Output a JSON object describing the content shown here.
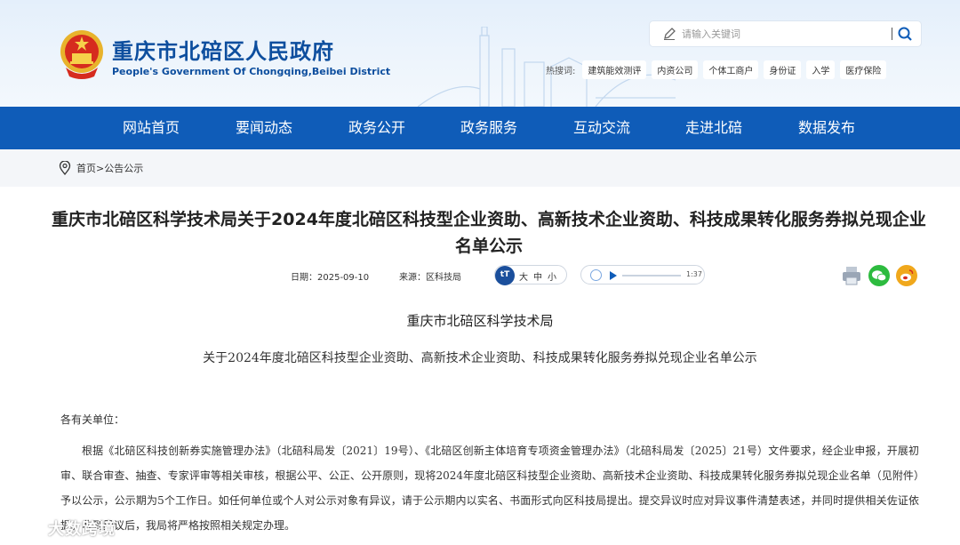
{
  "header": {
    "title": "重庆市北碚区人民政府",
    "subtitle": "People's Government Of Chongqing,Beibei District",
    "search_placeholder": "请输入关键词",
    "hot_label": "热搜词:",
    "hot_tags": [
      "建筑能效测评",
      "内资公司",
      "个体工商户",
      "身份证",
      "入学",
      "医疗保险"
    ]
  },
  "nav": {
    "items": [
      "网站首页",
      "要闻动态",
      "政务公开",
      "政务服务",
      "互动交流",
      "走进北碚",
      "数据发布"
    ],
    "active_index": 1
  },
  "breadcrumb": {
    "text": "首页>公告公示"
  },
  "article": {
    "title": "重庆市北碚区科学技术局关于2024年度北碚区科技型企业资助、高新技术企业资助、科技成果转化服务券拟兑现企业名单公示",
    "date": "日期：2025-09-10",
    "source": "来源：区科技局",
    "font_sizes": [
      "大",
      "中",
      "小"
    ],
    "font_icon": "tT",
    "audio_time": "1:37",
    "org": "重庆市北碚区科学技术局",
    "subtitle": "关于2024年度北碚区科技型企业资助、高新技术企业资助、科技成果转化服务券拟兑现企业名单公示",
    "salutation": "各有关单位：",
    "body": "根据《北碚区科技创新券实施管理办法》（北碚科局发〔2021〕19号）、《北碚区创新主体培育专项资金管理办法》（北碚科局发〔2025〕21号）文件要求，经企业申报，开展初审、联合审查、抽查、专家评审等相关审核，根据公平、公正、公开原则，现将2024年度北碚区科技型企业资助、高新技术企业资助、科技成果转化服务券拟兑现企业名单（见附件）予以公示，公示期为5个工作日。如任何单位或个人对公示对象有异议，请于公示期内以实名、书面形式向区科技局提出。提交异议时应对异议事件清楚表述，并同时提供相关佐证依据。收到异议后，我局将严格按照相关规定办理。"
  },
  "watermark": {
    "text": "大数跨境"
  },
  "colors": {
    "primary": "#0f5cb8",
    "title": "#0d4e9e",
    "wechat": "#2dbb3f",
    "weibo": "#f0a81c"
  },
  "icons": [
    "national-emblem-icon",
    "pencil-icon",
    "search-icon",
    "location-pin-icon",
    "speaker-icon",
    "play-icon",
    "print-icon",
    "wechat-icon",
    "weibo-icon"
  ]
}
